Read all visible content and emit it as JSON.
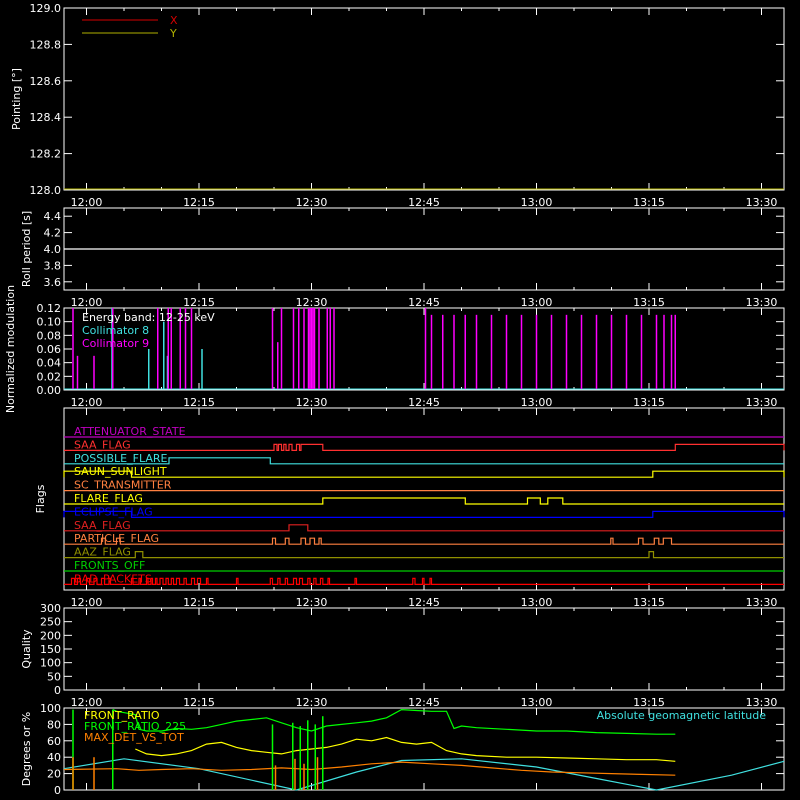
{
  "time_axis": {
    "ticks": [
      "12:00",
      "12:15",
      "12:30",
      "12:45",
      "13:00",
      "13:15",
      "13:30"
    ],
    "range_minutes": [
      -3,
      93
    ]
  },
  "chart_data": [
    {
      "type": "line",
      "ylabel": "Pointing [°]",
      "ylim": [
        128.0,
        129.0
      ],
      "yticks": [
        "128.0",
        "128.2",
        "128.4",
        "128.6",
        "128.8",
        "129.0"
      ],
      "legend": {
        "placement": "top-left"
      },
      "series": [
        {
          "name": "X",
          "color": "#d40000",
          "values": []
        },
        {
          "name": "Y",
          "color": "#b0b000",
          "values": []
        }
      ]
    },
    {
      "type": "line",
      "ylabel": "Roll period [s]",
      "ylim": [
        3.5,
        4.5
      ],
      "yticks": [
        "3.6",
        "3.8",
        "4.0",
        "4.2",
        "4.4"
      ],
      "series": [
        {
          "name": "",
          "color": "#ffffff",
          "x": [
            -3,
            93
          ],
          "y": [
            4.0,
            4.0
          ]
        }
      ]
    },
    {
      "type": "bar",
      "ylabel": "Normalized modulation",
      "ylim": [
        0.0,
        0.12
      ],
      "yticks": [
        "0.00",
        "0.02",
        "0.04",
        "0.06",
        "0.08",
        "0.10",
        "0.12"
      ],
      "annotation": "Energy band: 12-25 keV",
      "legend": {
        "placement": "top-left"
      },
      "series": [
        {
          "name": "Collimator 8",
          "color": "#40e0e0",
          "x": [
            3.4,
            8.3,
            10.3,
            10.8,
            15.4
          ],
          "y": [
            0.12,
            0.06,
            0.1,
            0.05,
            0.06
          ]
        },
        {
          "name": "Collimator 9",
          "color": "#ff00ff",
          "x": [
            -1.8,
            -1.2,
            1.0,
            3.5,
            9.5,
            10.9,
            11.3,
            12.5,
            13.2,
            14.0,
            24.8,
            25.5,
            26.0,
            27.6,
            28.3,
            29.0,
            29.6,
            29.8,
            30.0,
            30.2,
            30.4,
            31.0,
            32.1,
            32.5,
            33.0,
            45.2,
            46.0,
            47.5,
            49.0,
            50.5,
            52.0,
            54.0,
            56.0,
            58.0,
            60.0,
            62.0,
            64.0,
            66.0,
            68.0,
            70.0,
            72.0,
            74.0,
            76.0,
            77.0,
            78.0,
            78.5
          ],
          "y": [
            0.12,
            0.05,
            0.05,
            0.12,
            0.12,
            0.12,
            0.12,
            0.12,
            0.12,
            0.12,
            0.12,
            0.07,
            0.12,
            0.12,
            0.12,
            0.12,
            0.12,
            0.12,
            0.12,
            0.12,
            0.12,
            0.12,
            0.12,
            0.12,
            0.12,
            0.12,
            0.11,
            0.11,
            0.11,
            0.11,
            0.11,
            0.11,
            0.11,
            0.11,
            0.11,
            0.11,
            0.11,
            0.11,
            0.11,
            0.11,
            0.11,
            0.11,
            0.11,
            0.11,
            0.11,
            0.11
          ]
        }
      ]
    },
    {
      "type": "line",
      "ylabel": "Flags",
      "series": [
        {
          "name": "ATTENUATOR_STATE",
          "color": "#c000c0",
          "on": []
        },
        {
          "name": "SAA_FLAG",
          "color": "#ff3030",
          "on": [
            [
              25,
              25.4
            ],
            [
              25.6,
              26
            ],
            [
              26.3,
              26.6
            ],
            [
              27,
              27.4
            ],
            [
              28,
              28.4
            ],
            [
              28.6,
              31.5
            ],
            [
              78.5,
              93
            ]
          ]
        },
        {
          "name": "POSSIBLE_FLARE",
          "color": "#40e0e0",
          "on": [
            [
              11,
              24.5
            ]
          ]
        },
        {
          "name": "SAUN_SUNLIGHT",
          "color": "#ffff00",
          "on": [
            [
              -3,
              6
            ],
            [
              75.5,
              93
            ]
          ]
        },
        {
          "name": "SC_TRANSMITTER",
          "color": "#ff8040",
          "on": []
        },
        {
          "name": "FLARE_FLAG",
          "color": "#ffff00",
          "on": [
            [
              31.5,
              50.5
            ],
            [
              58.8,
              60.5
            ],
            [
              61.5,
              63.5
            ]
          ]
        },
        {
          "name": "ECLIPSE_FLAG",
          "color": "#0000ff",
          "on": [
            [
              -3,
              6
            ],
            [
              75.5,
              93
            ]
          ]
        },
        {
          "name": "SAA_FLAG",
          "color": "#e02020",
          "on": [
            [
              27,
              29.5
            ]
          ]
        },
        {
          "name": "PARTICLE_FLAG",
          "color": "#ff8040",
          "on": [
            [
              2,
              2.5
            ],
            [
              4,
              4.5
            ],
            [
              24.8,
              25.2
            ],
            [
              26.5,
              27
            ],
            [
              28.6,
              29.2
            ],
            [
              29.8,
              30.4
            ],
            [
              31,
              31.3
            ],
            [
              69.9,
              70.2
            ],
            [
              73.6,
              74.2
            ],
            [
              75.7,
              76.3
            ],
            [
              76.9,
              78
            ]
          ]
        },
        {
          "name": "AAZ_FLAG",
          "color": "#909000",
          "on": [
            [
              6.5,
              7.5
            ],
            [
              75,
              75.6
            ]
          ]
        },
        {
          "name": "FRONTS_OFF",
          "color": "#00d000",
          "on": []
        },
        {
          "name": "BAD_PACKETS",
          "color": "#ff0000",
          "on": [
            [
              -2,
              -1.6
            ],
            [
              -1.2,
              -0.8
            ],
            [
              0,
              0.4
            ],
            [
              1,
              1.4
            ],
            [
              2,
              2.4
            ],
            [
              3,
              3.2
            ],
            [
              6,
              6.2
            ],
            [
              7,
              7.2
            ],
            [
              8,
              8.2
            ],
            [
              8.6,
              8.8
            ],
            [
              9.2,
              9.4
            ],
            [
              9.8,
              10.2
            ],
            [
              10.6,
              10.9
            ],
            [
              11.3,
              11.6
            ],
            [
              12,
              12.4
            ],
            [
              13,
              13.3
            ],
            [
              14,
              14.4
            ],
            [
              14.8,
              15.2
            ],
            [
              16,
              16.2
            ],
            [
              20,
              20.2
            ],
            [
              24.5,
              24.8
            ],
            [
              25.5,
              25.8
            ],
            [
              26.5,
              26.8
            ],
            [
              27.6,
              28
            ],
            [
              28.4,
              28.8
            ],
            [
              29.5,
              29.8
            ],
            [
              30.3,
              30.6
            ],
            [
              31.2,
              31.5
            ],
            [
              32.2,
              32.4
            ],
            [
              35.8,
              36
            ],
            [
              43.5,
              43.8
            ],
            [
              44.8,
              45
            ],
            [
              45.8,
              46
            ]
          ]
        }
      ]
    },
    {
      "type": "line",
      "ylabel": "Quality",
      "ylim": [
        0,
        300
      ],
      "yticks": [
        "0",
        "50",
        "100",
        "150",
        "200",
        "250",
        "300"
      ],
      "series": []
    },
    {
      "type": "line",
      "ylabel": "Degrees or %",
      "ylim": [
        0,
        100
      ],
      "yticks": [
        "0",
        "20",
        "40",
        "60",
        "80",
        "100"
      ],
      "series": [
        {
          "name": "FRONT_RATIO",
          "color": "#ffff00",
          "x": [
            6.5,
            8,
            10,
            12,
            14,
            16,
            18,
            20,
            22,
            24,
            26,
            28,
            30,
            32,
            34,
            36,
            38,
            40,
            42,
            44,
            46,
            48,
            50,
            52,
            56,
            60,
            64,
            68,
            72,
            76,
            78.5
          ],
          "y": [
            50,
            44,
            42,
            44,
            48,
            56,
            58,
            52,
            48,
            46,
            44,
            48,
            50,
            52,
            56,
            62,
            60,
            64,
            58,
            56,
            58,
            48,
            44,
            42,
            40,
            40,
            39,
            38,
            37,
            37,
            35
          ]
        },
        {
          "name": "FRONT_RATIO_225",
          "color": "#00ff00",
          "x": [
            3.5,
            4,
            6.5,
            7,
            8,
            10,
            12,
            14,
            16,
            18,
            20,
            22,
            24,
            26,
            28,
            30,
            32,
            34,
            36,
            38,
            40,
            42,
            44,
            46,
            48,
            49,
            50,
            52,
            56,
            60,
            64,
            68,
            72,
            76,
            78.5
          ],
          "y": [
            98,
            96,
            92,
            74,
            72,
            72,
            75,
            74,
            76,
            80,
            84,
            86,
            88,
            82,
            76,
            72,
            78,
            80,
            82,
            84,
            88,
            98,
            97,
            96,
            96,
            75,
            78,
            76,
            74,
            72,
            72,
            70,
            69,
            68,
            68
          ]
        },
        {
          "name": "MAX_DET_VS_TOT",
          "color": "#ff8000",
          "x": [
            -3,
            4,
            7,
            10,
            14,
            18,
            22,
            26,
            30,
            34,
            38,
            42,
            46,
            50,
            54,
            58,
            62,
            66,
            70,
            74,
            78.5
          ],
          "y": [
            25,
            26,
            24,
            25,
            26,
            24,
            25,
            27,
            25,
            28,
            32,
            34,
            32,
            30,
            27,
            24,
            22,
            21,
            20,
            19,
            18
          ]
        },
        {
          "name": "Absolute geomagnetic latitude",
          "color": "#40e0e0",
          "x": [
            -3,
            5,
            15,
            28,
            36,
            42,
            50,
            60,
            68,
            76,
            86,
            93
          ],
          "y": [
            26,
            38,
            26,
            0,
            22,
            36,
            38,
            28,
            14,
            0,
            18,
            35
          ]
        }
      ]
    }
  ]
}
